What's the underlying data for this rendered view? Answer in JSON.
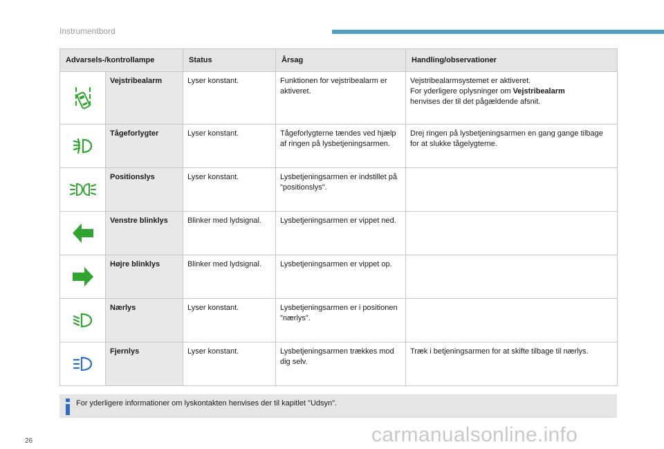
{
  "header": {
    "section_title": "Instrumentbord",
    "accent_color": "#4e9fbd"
  },
  "table": {
    "columns": [
      "Advarsels-/kontrollampe",
      "Status",
      "Årsag",
      "Handling/observationer"
    ],
    "rows": [
      {
        "icon": "lane-departure-icon",
        "icon_color": "#2fa52f",
        "name": "Vejstribealarm",
        "status": "Lyser konstant.",
        "cause": "Funktionen for vejstribealarm er aktiveret.",
        "action_line1": "Vejstribealarmsystemet er aktiveret.",
        "action_line2_pre": "For yderligere oplysninger om ",
        "action_line2_bold": "Vejstribealarm",
        "action_line3": "henvises der til det pågældende afsnit."
      },
      {
        "icon": "front-fog-light-icon",
        "icon_color": "#2fa52f",
        "name": "Tågeforlygter",
        "status": "Lyser konstant.",
        "cause": "Tågeforlygterne tændes ved hjælp af ringen på lysbetjeningsarmen.",
        "action": "Drej ringen på lysbetjeningsarmen en gang gange tilbage for at slukke tågelygterne."
      },
      {
        "icon": "position-lights-icon",
        "icon_color": "#2fa52f",
        "name": "Positionslys",
        "status": "Lyser konstant.",
        "cause": "Lysbetjeningsarmen er indstillet på \"positionslys\".",
        "action": ""
      },
      {
        "icon": "left-turn-signal-icon",
        "icon_color": "#2fa52f",
        "name": "Venstre blinklys",
        "status": "Blinker med lydsignal.",
        "cause": "Lysbetjeningsarmen er vippet ned.",
        "action": ""
      },
      {
        "icon": "right-turn-signal-icon",
        "icon_color": "#2fa52f",
        "name": "Højre blinklys",
        "status": "Blinker med lydsignal.",
        "cause": "Lysbetjeningsarmen er vippet op.",
        "action": ""
      },
      {
        "icon": "low-beam-icon",
        "icon_color": "#2fa52f",
        "name": "Nærlys",
        "status": "Lyser konstant.",
        "cause": "Lysbetjeningsarmen er i positionen \"nærlys\".",
        "action": ""
      },
      {
        "icon": "high-beam-icon",
        "icon_color": "#2d6fc4",
        "name": "Fjernlys",
        "status": "Lyser konstant.",
        "cause": "Lysbetjeningsarmen trækkes mod dig selv.",
        "action": "Træk i betjeningsarmen for at skifte tilbage til nærlys."
      }
    ]
  },
  "info": {
    "icon": "info-icon",
    "icon_color": "#2d6fc4",
    "text": "For yderligere informationer om lyskontakten henvises der til kapitlet \"Udsyn\"."
  },
  "footer": {
    "page_number": "26",
    "watermark": "carmanualsonline.info"
  }
}
